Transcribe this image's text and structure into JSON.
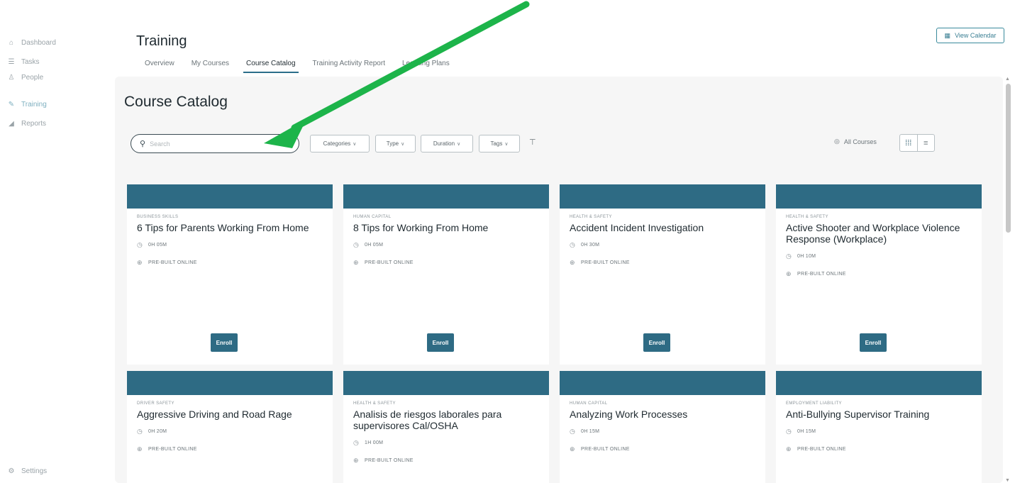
{
  "sidebar": {
    "items": [
      {
        "label": "Dashboard",
        "icon": "home-icon",
        "glyph": "⌂"
      },
      {
        "label": "Tasks",
        "icon": "list-icon",
        "glyph": "☰"
      },
      {
        "label": "People",
        "icon": "people-icon",
        "glyph": "♙"
      },
      {
        "label": "Training",
        "icon": "training-icon",
        "glyph": "✎"
      },
      {
        "label": "Reports",
        "icon": "reports-icon",
        "glyph": "◢"
      }
    ],
    "footer": {
      "label": "Settings",
      "icon": "settings-icon",
      "glyph": "⚙"
    }
  },
  "header": {
    "title": "Training",
    "tabs": [
      {
        "label": "Overview"
      },
      {
        "label": "My Courses"
      },
      {
        "label": "Course Catalog"
      },
      {
        "label": "Training Activity Report"
      },
      {
        "label": "Learning Plans"
      }
    ],
    "calendar_button": "View Calendar"
  },
  "catalog": {
    "title": "Course Catalog",
    "search_placeholder": "Search",
    "filters": [
      {
        "label": "Categories"
      },
      {
        "label": "Type"
      },
      {
        "label": "Duration"
      },
      {
        "label": "Tags"
      }
    ],
    "all_courses": "All Courses",
    "enroll_label": "Enroll"
  },
  "courses": [
    {
      "category": "Business Skills",
      "title": "6 Tips for Parents Working From Home",
      "duration": "0H 05M",
      "type": "PRE-BUILT ONLINE"
    },
    {
      "category": "Human Capital",
      "title": "8 Tips for Working From Home",
      "duration": "0H 05M",
      "type": "PRE-BUILT ONLINE"
    },
    {
      "category": "Health & Safety",
      "title": "Accident Incident Investigation",
      "duration": "0H 30M",
      "type": "PRE-BUILT ONLINE"
    },
    {
      "category": "Health & Safety",
      "title": "Active Shooter and Workplace Violence Response (Workplace)",
      "duration": "0H 10M",
      "type": "PRE-BUILT ONLINE"
    },
    {
      "category": "Driver Safety",
      "title": "Aggressive Driving and Road Rage",
      "duration": "0H 20M",
      "type": "PRE-BUILT ONLINE"
    },
    {
      "category": "Health & Safety",
      "title": "Analisis de riesgos laborales para supervisores Cal/OSHA",
      "duration": "1H 00M",
      "type": "PRE-BUILT ONLINE"
    },
    {
      "category": "Human Capital",
      "title": "Analyzing Work Processes",
      "duration": "0H 15M",
      "type": "PRE-BUILT ONLINE"
    },
    {
      "category": "Employment Liability",
      "title": "Anti-Bullying Supervisor Training",
      "duration": "0H 15M",
      "type": "PRE-BUILT ONLINE"
    }
  ],
  "colors": {
    "accent": "#2e6b84",
    "annotation_arrow": "#1db44a"
  }
}
